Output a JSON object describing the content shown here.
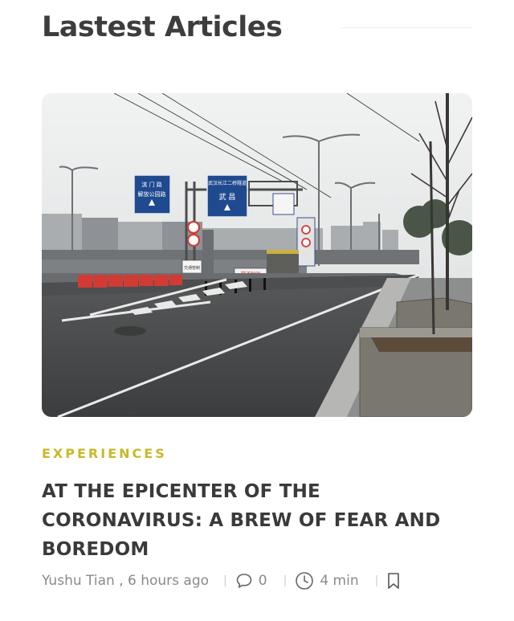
{
  "section": {
    "title": "Lastest Articles"
  },
  "article": {
    "category": "EXPERIENCES",
    "headline": "AT THE EPICENTER OF THE CORONAVIRUS: A BREW OF FEAR AND BOREDOM",
    "author_time": "Yushu Tian , 6 hours ago",
    "comment_count": "0",
    "read_time": "4 min",
    "image_alt": "Empty expressway with overhead road signs and barricades",
    "sign_text": {
      "left_sign_line1": "滨 门 路",
      "left_sign_line2": "解放公园路",
      "center_sign_line1": "武汉长江二桥隧道",
      "center_sign_line2": "武 昌",
      "barrier_label": "隧道封闭",
      "small_sign": "交通管制"
    }
  },
  "icons": {
    "comment": "speech-bubble-icon",
    "clock": "clock-icon",
    "bookmark": "bookmark-icon"
  },
  "colors": {
    "category": "#c8b92a",
    "title": "#3d3d3d",
    "meta": "#8a8a8a",
    "sign_blue": "#1f4a8f",
    "barrier_red": "#d23b33"
  }
}
